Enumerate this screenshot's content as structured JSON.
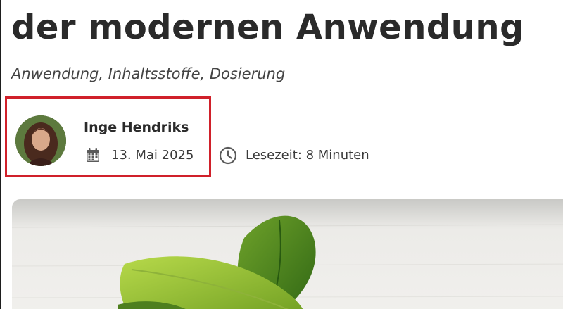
{
  "article": {
    "title": "der modernen Anwendung",
    "subtitle": "Anwendung, Inhaltsstoffe, Dosierung",
    "author": {
      "name": "Inge Hendriks"
    },
    "meta": {
      "date": "13. Mai 2025",
      "reading_time": "Lesezeit: 8 Minuten"
    }
  },
  "icons": {
    "date": "calendar-icon",
    "reading_time": "clock-icon"
  },
  "colors": {
    "highlight_border": "#d0202a",
    "text": "#2b2b2b",
    "icon": "#555555"
  }
}
